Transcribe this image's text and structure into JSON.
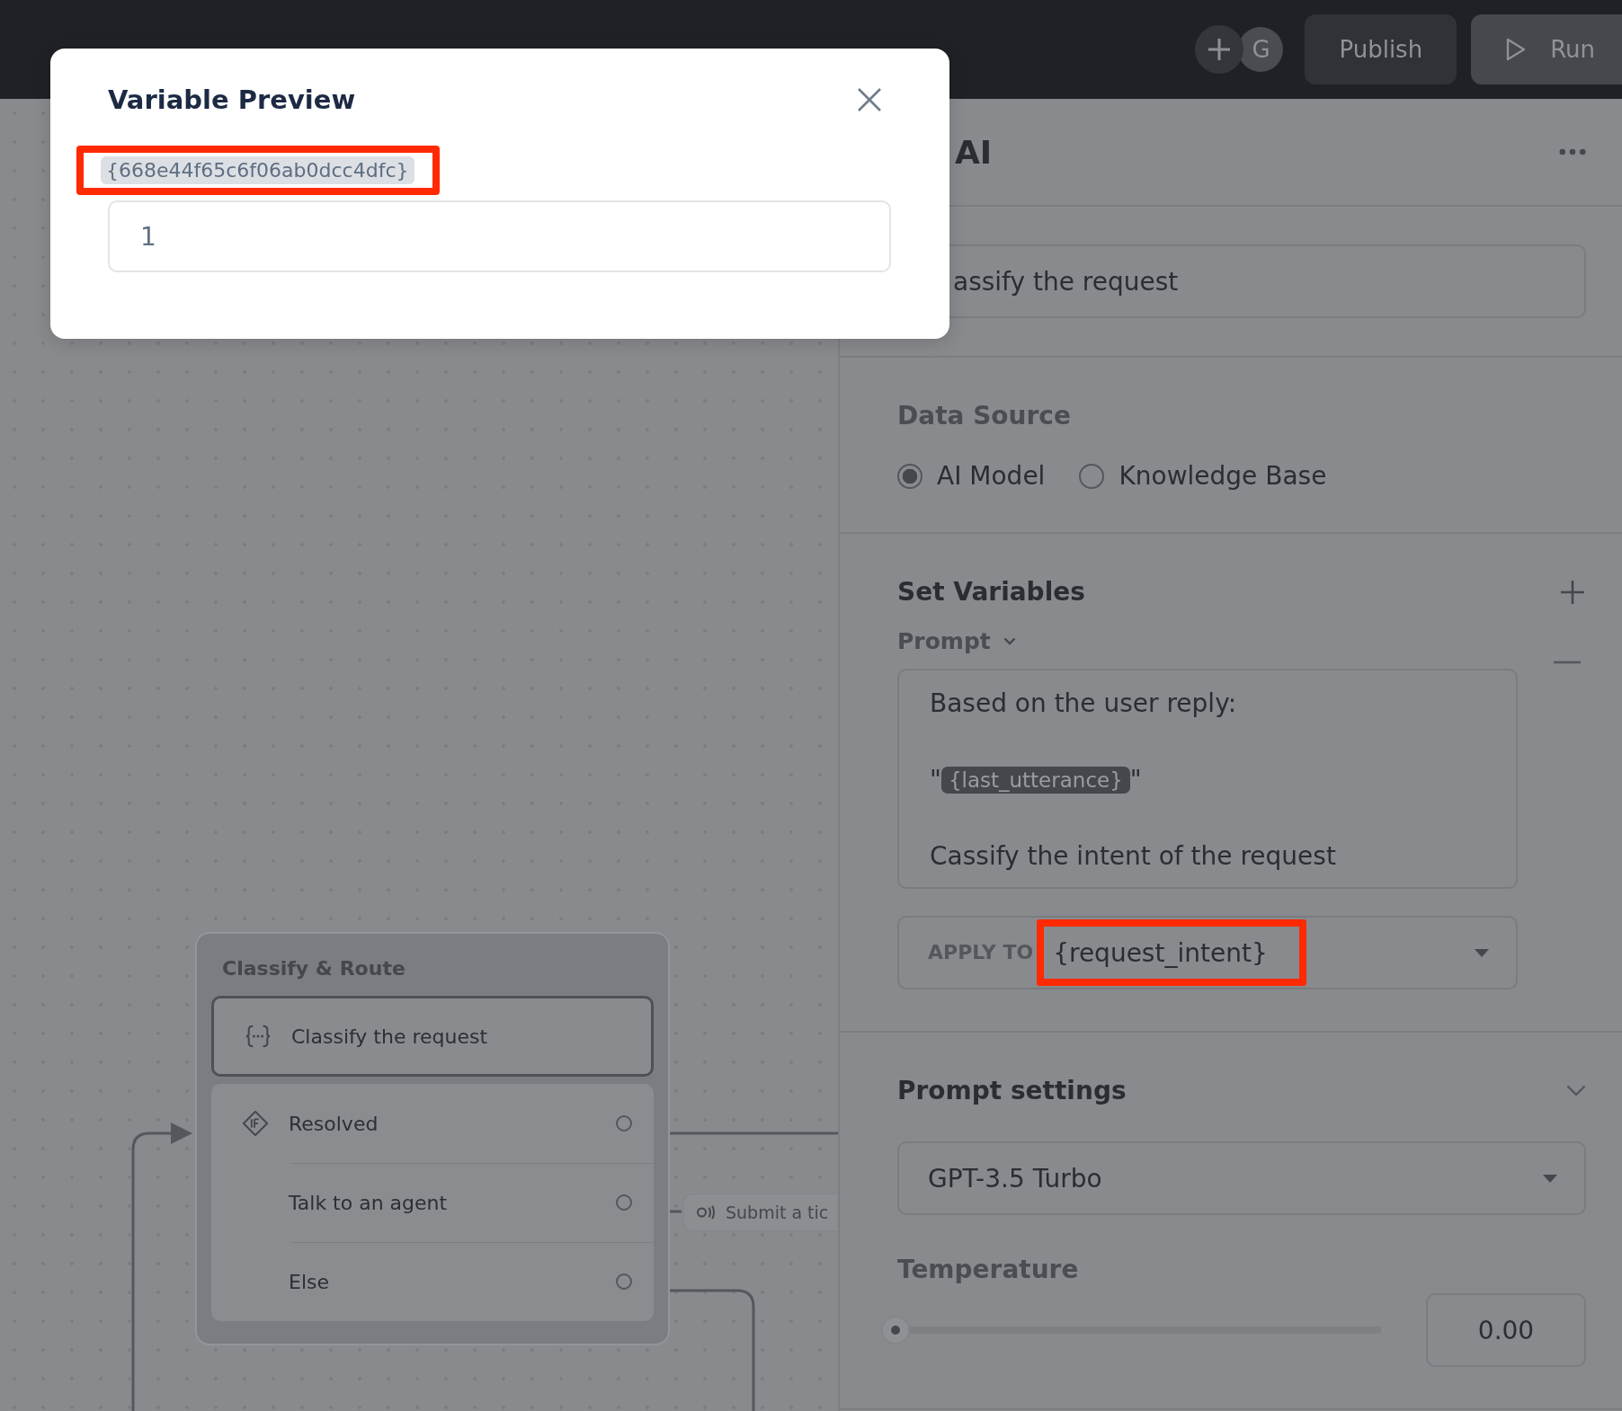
{
  "top_bar": {
    "avatar": "G",
    "publish": "Publish",
    "run": "Run"
  },
  "canvas": {
    "group": {
      "title": "Classify & Route",
      "step": "Classify the request",
      "conditions": [
        {
          "label": "Resolved",
          "icon": true
        },
        {
          "label": "Talk to an agent",
          "icon": false
        },
        {
          "label": "Else",
          "icon": false
        }
      ]
    },
    "chip": "Submit a tic"
  },
  "panel": {
    "title": "AI",
    "name_field": "assify the request",
    "data_source": {
      "title": "Data Source",
      "options": [
        {
          "label": "AI Model",
          "selected": true
        },
        {
          "label": "Knowledge Base",
          "selected": false
        }
      ]
    },
    "set_variables": {
      "title": "Set Variables",
      "prompt_label": "Prompt",
      "prompt_lines": [
        {
          "parts": [
            {
              "kind": "text",
              "text": "Based on the user reply:"
            }
          ]
        },
        {
          "parts": [
            {
              "kind": "text",
              "text": "\""
            },
            {
              "kind": "variable",
              "text": "{last_utterance}"
            },
            {
              "kind": "text",
              "text": "\""
            }
          ]
        },
        {
          "parts": [
            {
              "kind": "text",
              "text": "Cassify the intent of the request"
            }
          ]
        }
      ],
      "apply_to": {
        "label": "APPLY TO",
        "value": "{request_intent}",
        "highlighted": true
      }
    },
    "prompt_settings": {
      "title": "Prompt settings",
      "model": "GPT-3.5 Turbo",
      "temperature_label": "Temperature",
      "temperature": {
        "level": 0,
        "reading": "0.00"
      }
    }
  },
  "modal": {
    "title": "Variable Preview",
    "variable": {
      "text": "{668e44f65c6f06ab0dcc4dfc}",
      "highlighted": true
    },
    "value": "1"
  }
}
